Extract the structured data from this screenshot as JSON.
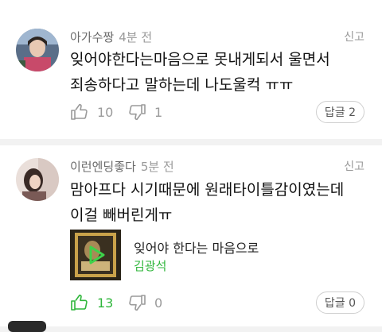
{
  "comments": [
    {
      "author": "아가수짱",
      "time": "4분 전",
      "report_label": "신고",
      "body_lines": [
        "잊어야한다는마음으로 못내게되서 울면서",
        "죄송하다고 말하는데 나도울컥 ㅠㅠ"
      ],
      "likes": "10",
      "dislikes": "1",
      "reply_label": "답글 2",
      "liked": false
    },
    {
      "author": "이런엔딩좋다",
      "time": "5분 전",
      "report_label": "신고",
      "body_lines": [
        "맘아프다 시기때문에 원래타이틀감이였는데",
        "이걸 빼버린게ㅠ"
      ],
      "music": {
        "title": "잊어야 한다는 마음으로",
        "artist": "김광석"
      },
      "likes": "13",
      "dislikes": "0",
      "reply_label": "답글 0",
      "liked": true
    }
  ],
  "colors": {
    "accent": "#2fb63b",
    "muted": "#9a9a9a",
    "background": "#f2f2f2"
  },
  "icons": [
    "thumbs-up-icon",
    "thumbs-down-icon",
    "play-icon"
  ]
}
